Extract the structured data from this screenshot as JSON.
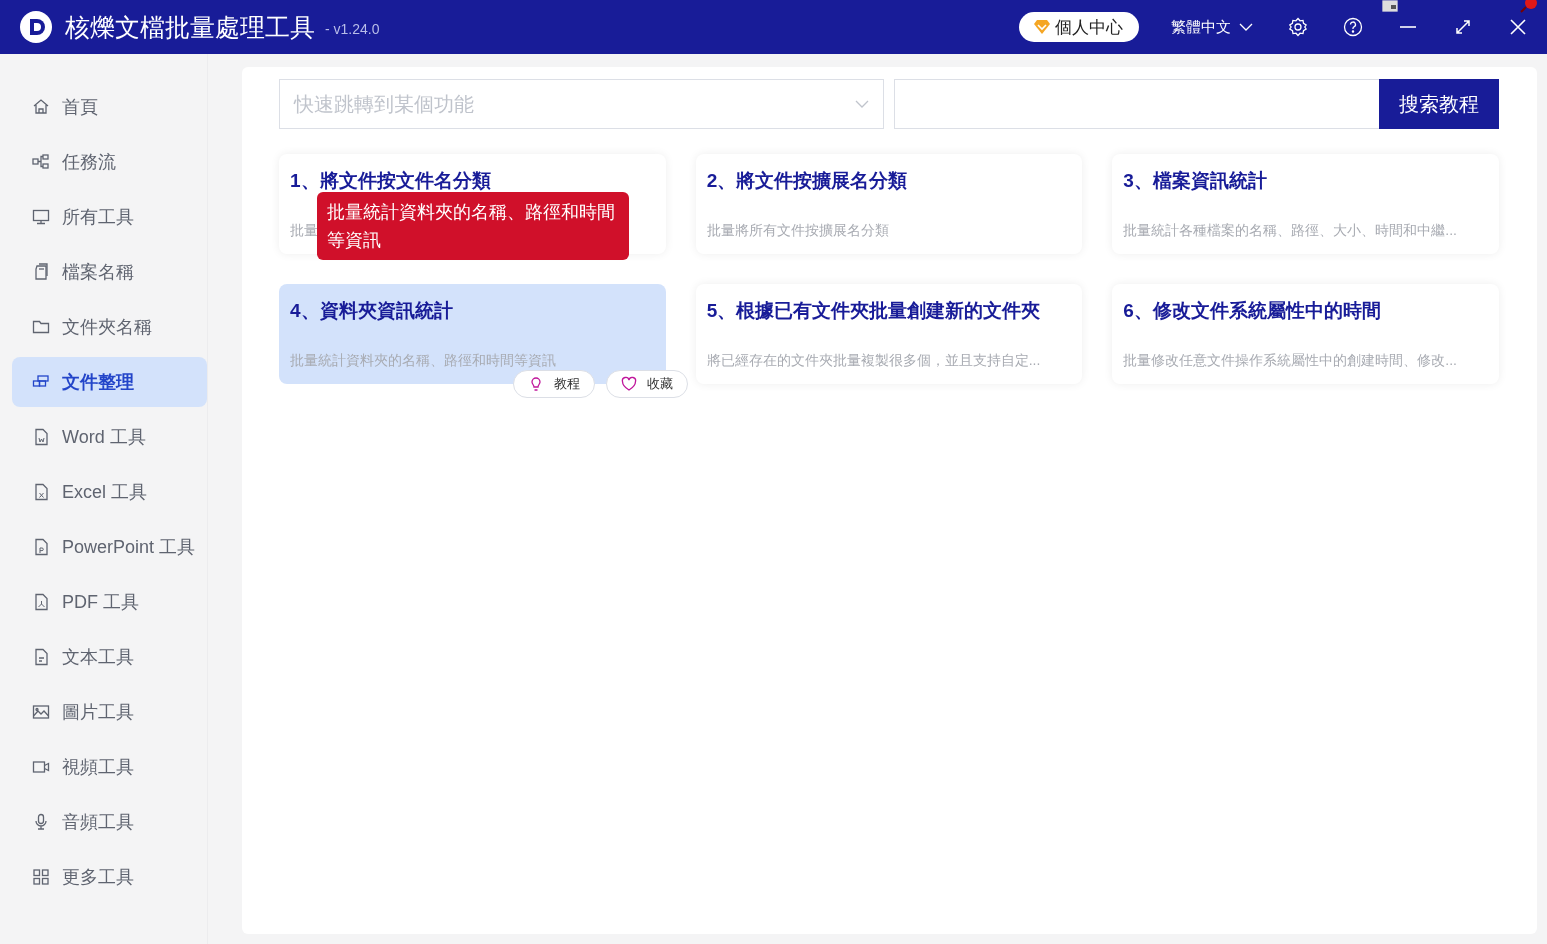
{
  "window": {
    "title": "核爍文檔批量處理工具",
    "version": "- v1.24.0",
    "user_button": "個人中心",
    "language": "繁體中文"
  },
  "sidebar": {
    "items": [
      {
        "label": "首頁",
        "selected": false
      },
      {
        "label": "任務流",
        "selected": false
      },
      {
        "label": "所有工具",
        "selected": false
      },
      {
        "label": "檔案名稱",
        "selected": false
      },
      {
        "label": "文件夾名稱",
        "selected": false
      },
      {
        "label": "文件整理",
        "selected": true
      },
      {
        "label": "Word 工具",
        "selected": false
      },
      {
        "label": "Excel 工具",
        "selected": false
      },
      {
        "label": "PowerPoint 工具",
        "selected": false
      },
      {
        "label": "PDF 工具",
        "selected": false
      },
      {
        "label": "文本工具",
        "selected": false
      },
      {
        "label": "圖片工具",
        "selected": false
      },
      {
        "label": "視頻工具",
        "selected": false
      },
      {
        "label": "音頻工具",
        "selected": false
      },
      {
        "label": "更多工具",
        "selected": false
      }
    ]
  },
  "search": {
    "jump_placeholder": "快速跳轉到某個功能",
    "button": "搜索教程"
  },
  "cards": [
    {
      "title": "1、將文件按文件名分類",
      "description": "批量",
      "highlighted": false
    },
    {
      "title": "2、將文件按擴展名分類",
      "description": "批量將所有文件按擴展名分類",
      "highlighted": false
    },
    {
      "title": "3、檔案資訊統計",
      "description": "批量統計各種檔案的名稱、路徑、大小、時間和中繼...",
      "highlighted": false
    },
    {
      "title": "4、資料夾資訊統計",
      "description": "批量統計資料夾的名稱、路徑和時間等資訊",
      "highlighted": true,
      "actions": [
        {
          "kind": "tutorial",
          "label": "教程"
        },
        {
          "kind": "favorite",
          "label": "收藏"
        }
      ]
    },
    {
      "title": "5、根據已有文件夾批量創建新的文件夾",
      "description": "將已經存在的文件夾批量複製很多個，並且支持自定...",
      "highlighted": false
    },
    {
      "title": "6、修改文件系統屬性中的時間",
      "description": "批量修改任意文件操作系統屬性中的創建時間、修改...",
      "highlighted": false
    }
  ],
  "tooltip": {
    "text": "批量統計資料夾的名稱、路徑和時間等資訊"
  }
}
